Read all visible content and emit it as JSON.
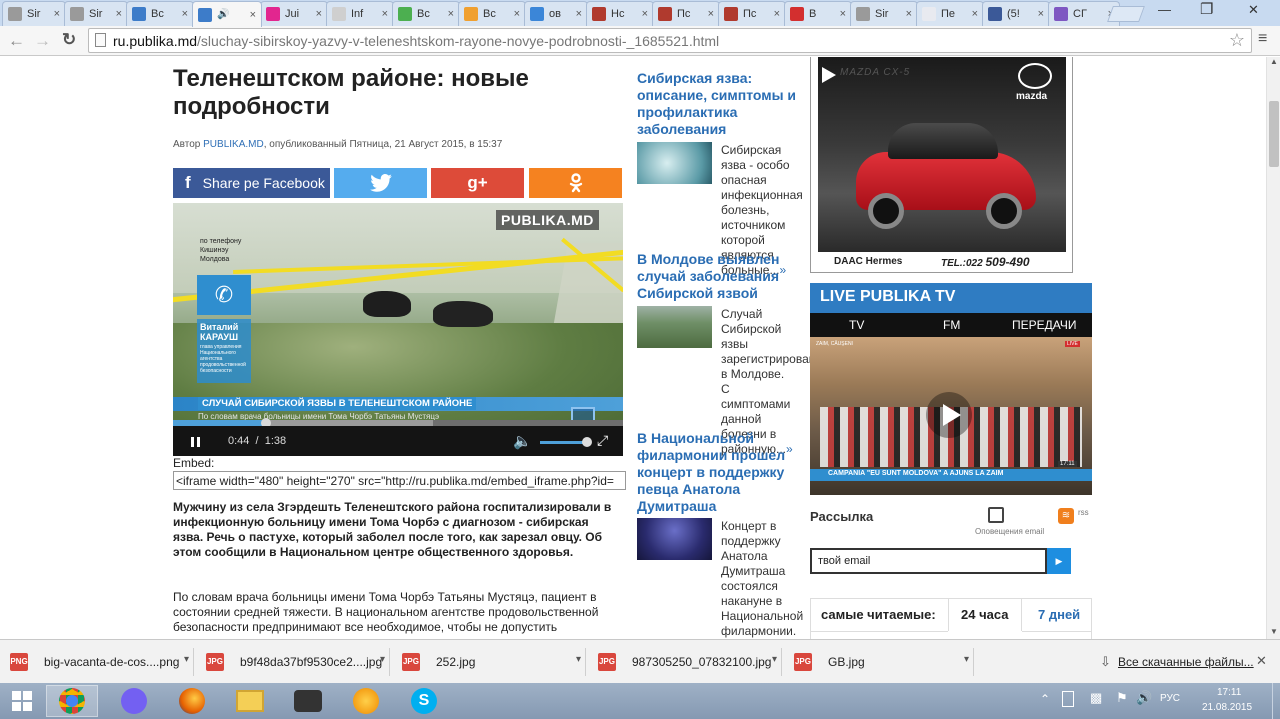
{
  "browser": {
    "tabs": [
      {
        "label": "Sir",
        "fav_color": "#9a9a9a"
      },
      {
        "label": "Sir",
        "fav_color": "#9a9a9a"
      },
      {
        "label": "Вс",
        "fav_color": "#3d7cc9"
      },
      {
        "label": "",
        "fav_color": "#3d7cc9",
        "active": true
      },
      {
        "label": "Jui",
        "fav_color": "#e2268f"
      },
      {
        "label": "Inf",
        "fav_color": "#cfcfcf"
      },
      {
        "label": "Вс",
        "fav_color": "#4caf50"
      },
      {
        "label": "Вс",
        "fav_color": "#f0a030"
      },
      {
        "label": "ов",
        "fav_color": "#3b86d8"
      },
      {
        "label": "Нс",
        "fav_color": "#b03a2e"
      },
      {
        "label": "Пс",
        "fav_color": "#b03a2e"
      },
      {
        "label": "Пс",
        "fav_color": "#b03a2e"
      },
      {
        "label": "В",
        "fav_color": "#d32f2f"
      },
      {
        "label": "Sir",
        "fav_color": "#9a9a9a"
      },
      {
        "label": "Пе",
        "fav_color": "#e8eaf0"
      },
      {
        "label": "(5!",
        "fav_color": "#3b5998"
      },
      {
        "label": "СГ",
        "fav_color": "#7e57c2"
      }
    ],
    "url_host": "ru.publika.md",
    "url_path": "/sluchay-sibirskoy-yazvy-v-teleneshtskom-rayone-novye-podrobnosti-_1685521.html"
  },
  "article": {
    "title_line1": "Теленештском районе: новые",
    "title_line2": "подробности",
    "meta_prefix": "Автор ",
    "meta_author": "PUBLIKA.MD",
    "meta_suffix": ", опубликованный Пятница, 21 Август 2015, в 15:37",
    "share_facebook": "Share pe Facebook",
    "share_gplus": "g+",
    "video": {
      "logo": "PUBLIKA.MD",
      "caller_lines": [
        "по телефону",
        "Кишинэу",
        "Молдова"
      ],
      "name_first": "Виталий",
      "name_last": "КАРАУШ",
      "role": "глава управления Национального агентства продовольственной безопасности",
      "headline": "СЛУЧАЙ СИБИРСКОЙ ЯЗВЫ В ТЕЛЕНЕШТСКОМ РАЙОНЕ",
      "ticker": "По словам врача больницы имени Тома Чорбэ Татьяны Мустяцэ",
      "time_current": "0:44",
      "time_sep": "/",
      "time_total": "1:38",
      "progress_fraction": 0.449
    },
    "embed_label": "Embed:",
    "embed_code": "<iframe width=\"480\" height=\"270\" src=\"http://ru.publika.md/embed_iframe.php?id=",
    "lead": "Мужчину из села Згэрдешть Теленештского района госпитализировали в инфекционную больницу имени Тома Чорбэ с диагнозом - сибирская язва. Речь о пастухе, который заболел после того, как зарезал овцу. Об этом сообщили в Национальном центре общественного здоровья.",
    "para1": "По словам врача больницы имени Тома Чорбэ Татьяны Мустяцэ, пациент в состоянии средней тяжести. В национальном агентстве продовольственной безопасности предпринимают все необходимое, чтобы не допустить"
  },
  "related": [
    {
      "title": "Сибирская язва: описание, симптомы и профилактика заболевания",
      "text": "Сибирская язва - особо опасная инфекционная болезнь, источником которой являются больные...",
      "more": "»"
    },
    {
      "title": "В Молдове выявлен случай заболевания Сибирской язвой",
      "text": "Случай Сибирской язвы зарегистрирован в Молдове. С симптомами данной болезни в районную...",
      "more": "»"
    },
    {
      "title": "В Национальной филармонии прошел концерт в поддержку певца Анатола Думитраша",
      "text": "Концерт в поддержку Анатола Думитраша состоялся накануне в Национальной филармонии. Коллеги по...",
      "more": "»"
    }
  ],
  "ad": {
    "brand": "mazda",
    "model": "MAZDA CX-5",
    "dealer": "DAAC Hermes",
    "phone_prefix": "TEL.:022 ",
    "phone_number": "509-490"
  },
  "live": {
    "title": "LIVE PUBLIKA TV",
    "tabs": [
      "TV",
      "FM",
      "ПЕРЕДАЧИ"
    ],
    "banner": "CAMPANIA \"EU SUNT MOLDOVA\" A AJUNS LA ZAIM",
    "badge": "LIVE",
    "clock": "17:11",
    "place": "ZAIM, CĂUŞENI"
  },
  "newsletter": {
    "title": "Рассылка",
    "alert_label": "Оповещения email",
    "rss_label": "rss",
    "placeholder": "твой email"
  },
  "most_read": {
    "title": "самые читаемые:",
    "tabs": [
      "24 часа",
      "7 дней"
    ]
  },
  "downloads": {
    "items": [
      "big-vacanta-de-cos....png",
      "b9f48da37bf9530ce2....jpg",
      "252.jpg",
      "987305250_07832100.jpg",
      "GB.jpg"
    ],
    "show_all": "Все скачанные файлы..."
  },
  "taskbar": {
    "lang": "РУС",
    "time": "17:11",
    "date": "21.08.2015"
  }
}
